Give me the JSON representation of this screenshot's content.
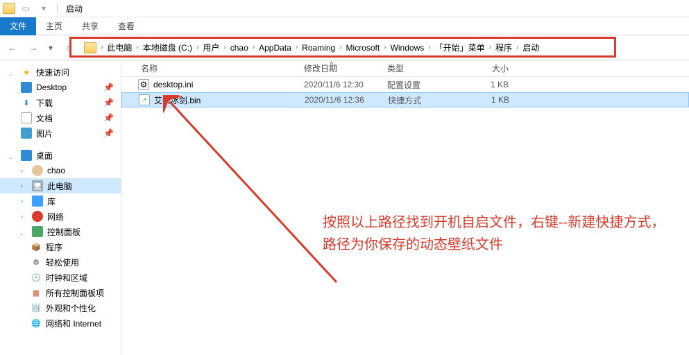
{
  "window_title": "启动",
  "ribbon": {
    "file": "文件",
    "tabs": [
      "主页",
      "共享",
      "查看"
    ]
  },
  "breadcrumb": [
    "此电脑",
    "本地磁盘 (C:)",
    "用户",
    "chao",
    "AppData",
    "Roaming",
    "Microsoft",
    "Windows",
    "「开始」菜单",
    "程序",
    "启动"
  ],
  "columns": {
    "name": "名称",
    "date": "修改日期",
    "type": "类型",
    "size": "大小"
  },
  "files": [
    {
      "name": "desktop.ini",
      "date": "2020/11/6 12:30",
      "type": "配置设置",
      "size": "1 KB",
      "selected": false,
      "shortcut": false
    },
    {
      "name": "艾希冰剑.bin",
      "date": "2020/11/6 12:36",
      "type": "快捷方式",
      "size": "1 KB",
      "selected": true,
      "shortcut": true
    }
  ],
  "sidebar": {
    "quick": "快速访问",
    "desktop": "Desktop",
    "downloads": "下载",
    "documents": "文档",
    "pictures": "图片",
    "desk_cn": "桌面",
    "user": "chao",
    "this_pc": "此电脑",
    "libraries": "库",
    "network": "网络",
    "cpl": "控制面板",
    "programs": "程序",
    "ease": "轻松使用",
    "clock": "时钟和区域",
    "allcpl": "所有控制面板项",
    "theme": "外观和个性化",
    "netint": "网络和 Internet"
  },
  "annotation": "按照以上路径找到开机自启文件，右键--新建快捷方式，路径为你保存的动态壁纸文件"
}
